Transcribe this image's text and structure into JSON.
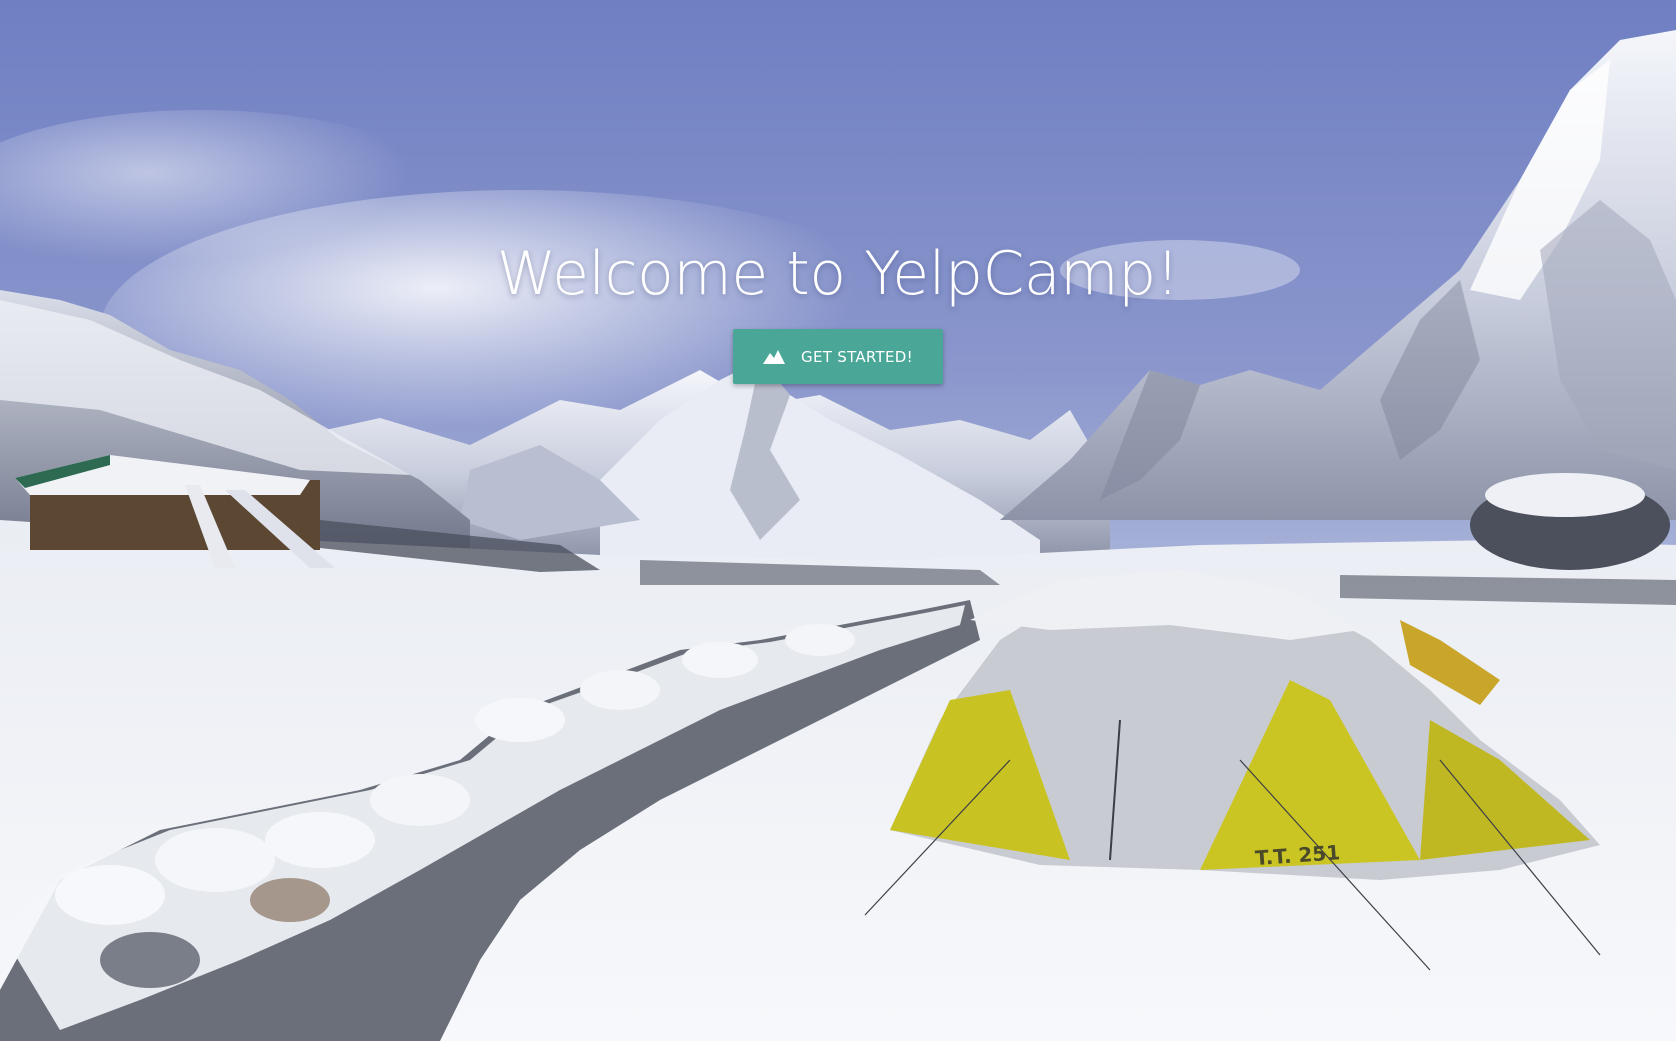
{
  "hero": {
    "title": "Welcome to YelpCamp!",
    "cta_label": "GET STARTED!",
    "cta_icon": "mountain-icon"
  },
  "tent": {
    "tag": "T.T. 251"
  },
  "colors": {
    "cta_background": "#4aa696",
    "title_text": "#ffffff"
  }
}
